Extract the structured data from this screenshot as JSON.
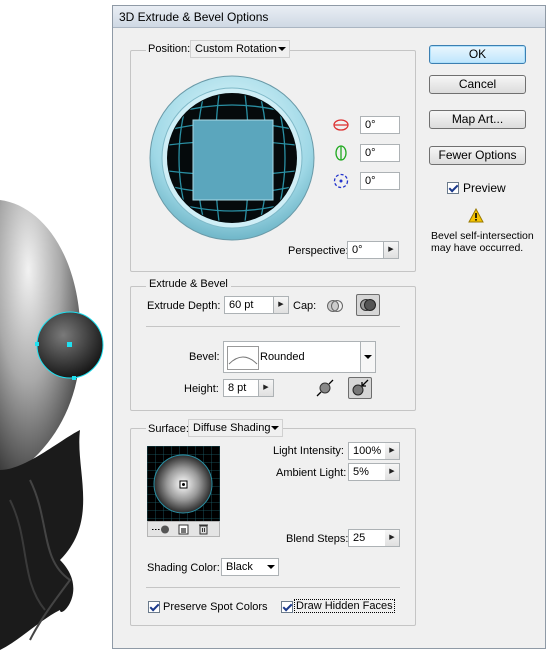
{
  "dialog": {
    "title": "3D Extrude & Bevel Options",
    "buttons": {
      "ok": "OK",
      "cancel": "Cancel",
      "map_art": "Map Art...",
      "fewer_options": "Fewer Options"
    },
    "preview": {
      "label": "Preview",
      "checked": true
    },
    "warning": {
      "line1": "Bevel self-intersection",
      "line2": "may have occurred.",
      "icon": "warning-icon"
    }
  },
  "position": {
    "label": "Position:",
    "value": "Custom Rotation",
    "rotation": {
      "x": "0°",
      "y": "0°",
      "z": "0°"
    },
    "perspective_label": "Perspective:",
    "perspective_value": "0°"
  },
  "extrude": {
    "group_title": "Extrude & Bevel",
    "depth_label": "Extrude Depth:",
    "depth_value": "60 pt",
    "cap_label": "Cap:",
    "bevel_label": "Bevel:",
    "bevel_value": "Rounded",
    "height_label": "Height:",
    "height_value": "8 pt"
  },
  "surface": {
    "label": "Surface:",
    "value": "Diffuse Shading",
    "light_intensity_label": "Light Intensity:",
    "light_intensity_value": "100%",
    "ambient_label": "Ambient Light:",
    "ambient_value": "5%",
    "blend_steps_label": "Blend Steps:",
    "blend_steps_value": "25",
    "shading_color_label": "Shading Color:",
    "shading_color_value": "Black",
    "preserve_spot_label": "Preserve Spot Colors",
    "preserve_spot_checked": true,
    "draw_hidden_label": "Draw Hidden Faces",
    "draw_hidden_checked": true
  },
  "colors": {
    "accent": "#3c7fb1",
    "cube": "#5ba6bd",
    "trackball_ring": "#8fd3e3",
    "selection": "#1fe0f0"
  }
}
